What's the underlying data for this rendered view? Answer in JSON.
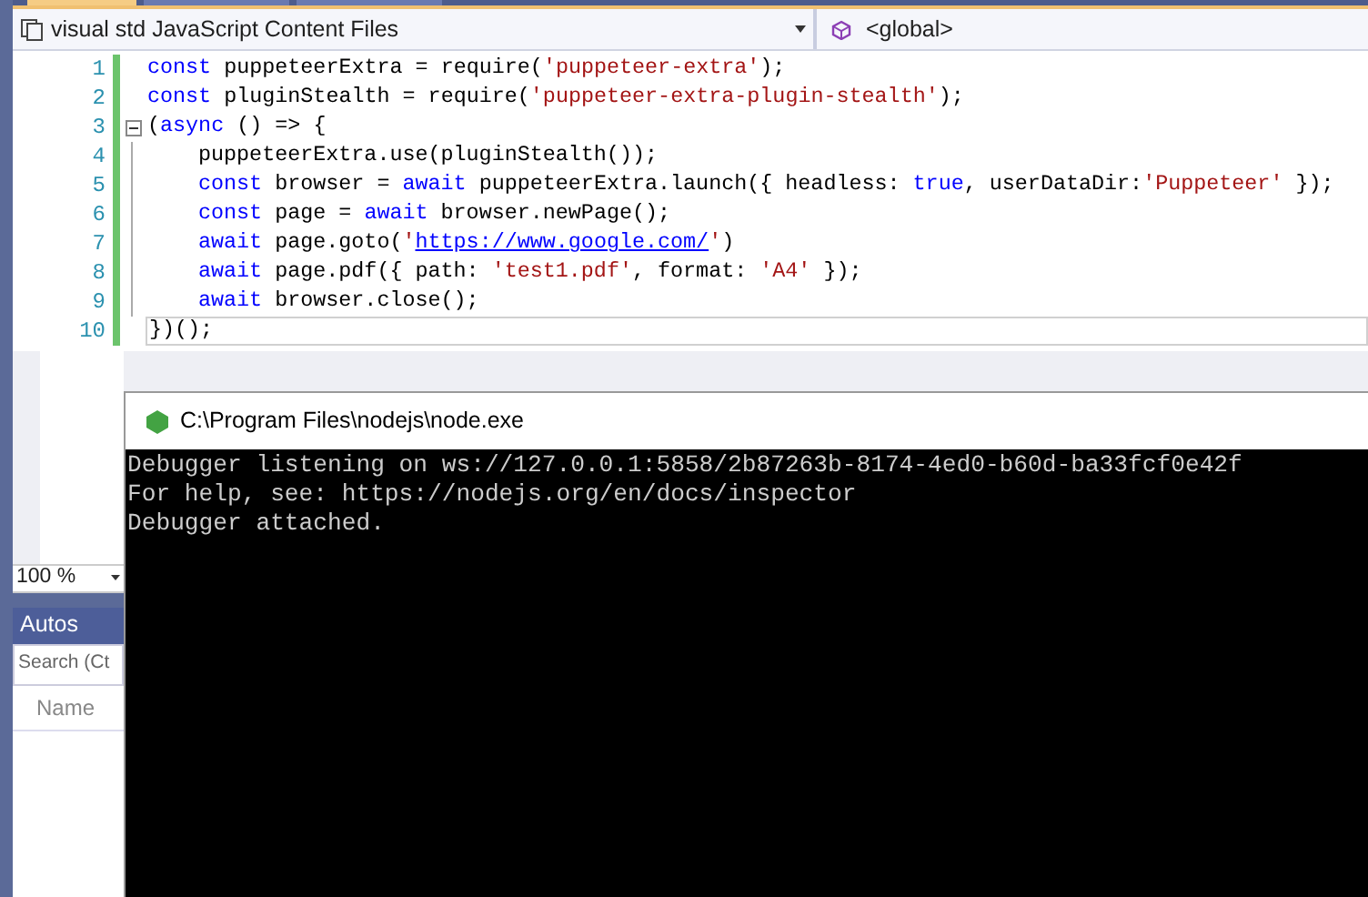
{
  "document_tabs": [
    {
      "selected": true
    },
    {
      "selected": false
    },
    {
      "selected": false
    }
  ],
  "navigation_bar": {
    "project": "visual std JavaScript Content Files",
    "scope": "<global>"
  },
  "editor": {
    "lines": [
      {
        "number": "1",
        "current": false,
        "tokens": [
          {
            "kind": "keyword",
            "text": "const"
          },
          {
            "kind": "plain",
            "text": " puppeteerExtra = require("
          },
          {
            "kind": "string",
            "text": "'puppeteer-extra'"
          },
          {
            "kind": "plain",
            "text": ");"
          }
        ]
      },
      {
        "number": "2",
        "current": false,
        "tokens": [
          {
            "kind": "keyword",
            "text": "const"
          },
          {
            "kind": "plain",
            "text": " pluginStealth = require("
          },
          {
            "kind": "string",
            "text": "'puppeteer-extra-plugin-stealth'"
          },
          {
            "kind": "plain",
            "text": ");"
          }
        ]
      },
      {
        "number": "3",
        "collapsible": true,
        "current": false,
        "tokens": [
          {
            "kind": "plain",
            "text": "("
          },
          {
            "kind": "keyword",
            "text": "async"
          },
          {
            "kind": "plain",
            "text": " () => {"
          }
        ]
      },
      {
        "number": "4",
        "current": false,
        "indented": true,
        "tokens": [
          {
            "kind": "plain",
            "text": "puppeteerExtra.use(pluginStealth());"
          }
        ]
      },
      {
        "number": "5",
        "current": false,
        "indented": true,
        "tokens": [
          {
            "kind": "keyword",
            "text": "const"
          },
          {
            "kind": "plain",
            "text": " browser = "
          },
          {
            "kind": "keyword",
            "text": "await"
          },
          {
            "kind": "plain",
            "text": " puppeteerExtra.launch({ headless: "
          },
          {
            "kind": "keyword",
            "text": "true"
          },
          {
            "kind": "plain",
            "text": ", userDataDir:"
          },
          {
            "kind": "string",
            "text": "'Puppeteer'"
          },
          {
            "kind": "plain",
            "text": " });"
          }
        ]
      },
      {
        "number": "6",
        "current": false,
        "indented": true,
        "tokens": [
          {
            "kind": "keyword",
            "text": "const"
          },
          {
            "kind": "plain",
            "text": " page = "
          },
          {
            "kind": "keyword",
            "text": "await"
          },
          {
            "kind": "plain",
            "text": " browser.newPage();"
          }
        ]
      },
      {
        "number": "7",
        "current": false,
        "indented": true,
        "tokens": [
          {
            "kind": "keyword",
            "text": "await"
          },
          {
            "kind": "plain",
            "text": " page.goto("
          },
          {
            "kind": "string",
            "text": "'"
          },
          {
            "kind": "link",
            "text": "https://www.google.com/"
          },
          {
            "kind": "string",
            "text": "'"
          },
          {
            "kind": "plain",
            "text": ")"
          }
        ]
      },
      {
        "number": "8",
        "current": false,
        "indented": true,
        "tokens": [
          {
            "kind": "keyword",
            "text": "await"
          },
          {
            "kind": "plain",
            "text": " page.pdf({ path: "
          },
          {
            "kind": "string",
            "text": "'test1.pdf'"
          },
          {
            "kind": "plain",
            "text": ", format: "
          },
          {
            "kind": "string",
            "text": "'A4'"
          },
          {
            "kind": "plain",
            "text": " });"
          }
        ]
      },
      {
        "number": "9",
        "current": false,
        "indented": true,
        "tokens": [
          {
            "kind": "keyword",
            "text": "await"
          },
          {
            "kind": "plain",
            "text": " browser.close();"
          }
        ]
      },
      {
        "number": "10",
        "current": true,
        "tokens": [
          {
            "kind": "plain",
            "text": "})();"
          }
        ]
      }
    ]
  },
  "zoom": "100 %",
  "autos_panel": {
    "title": "Autos",
    "search_placeholder": "Search (Ct",
    "columns": [
      "Name"
    ]
  },
  "console_window": {
    "title": "C:\\Program Files\\nodejs\\node.exe",
    "lines": [
      "Debugger listening on ws://127.0.0.1:5858/2b87263b-8174-4ed0-b60d-ba33fcf0e42f",
      "For help, see: https://nodejs.org/en/docs/inspector",
      "Debugger attached."
    ]
  }
}
